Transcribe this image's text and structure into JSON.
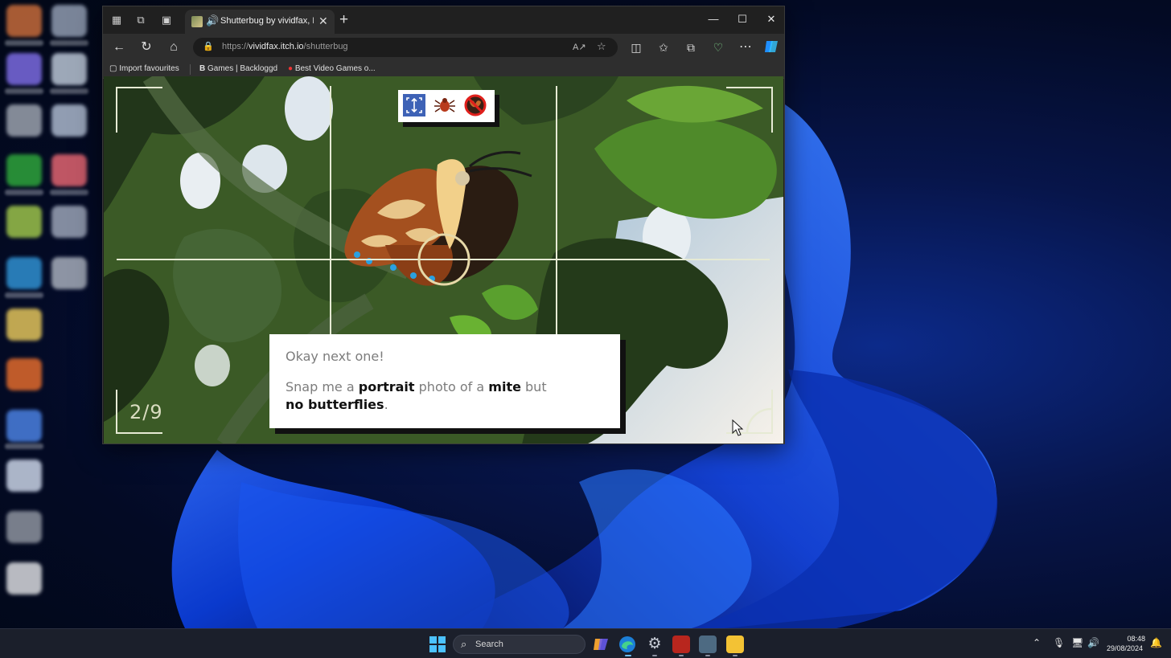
{
  "browser": {
    "tab_title": "Shutterbug by vividfax, Dan",
    "tab_close_symbol": "✕",
    "new_tab_symbol": "+",
    "url_prefix": "https://",
    "url_host": "vividfax.itch.io",
    "url_path": "/shutterbug",
    "bookmarks": [
      {
        "label": "Import favourites",
        "icon": "import-icon"
      },
      {
        "label": "Games | Backloggd",
        "icon": "backloggd-icon"
      },
      {
        "label": "Best Video Games o...",
        "icon": "red-circle-icon"
      }
    ],
    "icons": [
      "workspaces-icon",
      "tab-actions-icon",
      "vertical-tabs-icon",
      "back-icon",
      "refresh-icon",
      "home-icon",
      "lock-icon",
      "read-aloud-icon",
      "favorite-star-icon",
      "split-screen-icon",
      "favorites-icon",
      "collections-icon",
      "browser-essentials-icon",
      "more-icon",
      "copilot-icon"
    ]
  },
  "game": {
    "photo_counter": "2/9",
    "requirement_icons": [
      "portrait-frame-icon",
      "mite-icon",
      "no-butterfly-icon"
    ],
    "dialog": {
      "line1": "Okay next one!",
      "line2_p1": "Snap me a ",
      "line2_b1": "portrait",
      "line2_p2": " photo of a ",
      "line2_b2": "mite",
      "line2_p3": " but",
      "line2_b3": "no butterflies",
      "line2_p4": "."
    }
  },
  "taskbar": {
    "search_label": "Search",
    "time": "08:48",
    "date": "29/08/2024",
    "apps": [
      "copilot-app",
      "edge-app",
      "settings-app",
      "voicemeeter-app",
      "remote-desktop-app",
      "file-explorer-app"
    ]
  }
}
